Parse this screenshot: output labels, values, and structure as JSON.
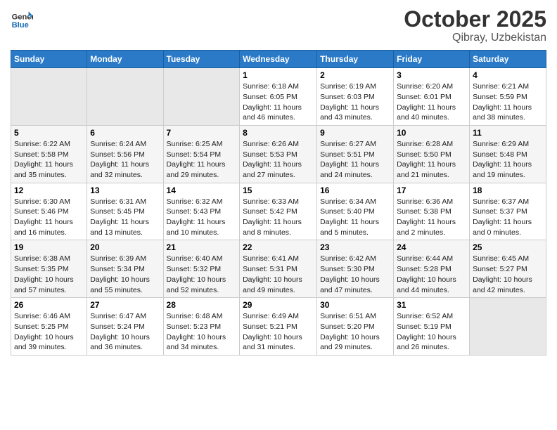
{
  "header": {
    "title": "October 2025",
    "location": "Qibray, Uzbekistan"
  },
  "calendar": {
    "days": [
      "Sunday",
      "Monday",
      "Tuesday",
      "Wednesday",
      "Thursday",
      "Friday",
      "Saturday"
    ]
  },
  "weeks": [
    [
      {
        "day": "",
        "sunrise": "",
        "sunset": "",
        "daylight": "",
        "empty": true
      },
      {
        "day": "",
        "sunrise": "",
        "sunset": "",
        "daylight": "",
        "empty": true
      },
      {
        "day": "",
        "sunrise": "",
        "sunset": "",
        "daylight": "",
        "empty": true
      },
      {
        "day": "1",
        "sunrise": "Sunrise: 6:18 AM",
        "sunset": "Sunset: 6:05 PM",
        "daylight": "Daylight: 11 hours and 46 minutes.",
        "empty": false
      },
      {
        "day": "2",
        "sunrise": "Sunrise: 6:19 AM",
        "sunset": "Sunset: 6:03 PM",
        "daylight": "Daylight: 11 hours and 43 minutes.",
        "empty": false
      },
      {
        "day": "3",
        "sunrise": "Sunrise: 6:20 AM",
        "sunset": "Sunset: 6:01 PM",
        "daylight": "Daylight: 11 hours and 40 minutes.",
        "empty": false
      },
      {
        "day": "4",
        "sunrise": "Sunrise: 6:21 AM",
        "sunset": "Sunset: 5:59 PM",
        "daylight": "Daylight: 11 hours and 38 minutes.",
        "empty": false
      }
    ],
    [
      {
        "day": "5",
        "sunrise": "Sunrise: 6:22 AM",
        "sunset": "Sunset: 5:58 PM",
        "daylight": "Daylight: 11 hours and 35 minutes.",
        "empty": false
      },
      {
        "day": "6",
        "sunrise": "Sunrise: 6:24 AM",
        "sunset": "Sunset: 5:56 PM",
        "daylight": "Daylight: 11 hours and 32 minutes.",
        "empty": false
      },
      {
        "day": "7",
        "sunrise": "Sunrise: 6:25 AM",
        "sunset": "Sunset: 5:54 PM",
        "daylight": "Daylight: 11 hours and 29 minutes.",
        "empty": false
      },
      {
        "day": "8",
        "sunrise": "Sunrise: 6:26 AM",
        "sunset": "Sunset: 5:53 PM",
        "daylight": "Daylight: 11 hours and 27 minutes.",
        "empty": false
      },
      {
        "day": "9",
        "sunrise": "Sunrise: 6:27 AM",
        "sunset": "Sunset: 5:51 PM",
        "daylight": "Daylight: 11 hours and 24 minutes.",
        "empty": false
      },
      {
        "day": "10",
        "sunrise": "Sunrise: 6:28 AM",
        "sunset": "Sunset: 5:50 PM",
        "daylight": "Daylight: 11 hours and 21 minutes.",
        "empty": false
      },
      {
        "day": "11",
        "sunrise": "Sunrise: 6:29 AM",
        "sunset": "Sunset: 5:48 PM",
        "daylight": "Daylight: 11 hours and 19 minutes.",
        "empty": false
      }
    ],
    [
      {
        "day": "12",
        "sunrise": "Sunrise: 6:30 AM",
        "sunset": "Sunset: 5:46 PM",
        "daylight": "Daylight: 11 hours and 16 minutes.",
        "empty": false
      },
      {
        "day": "13",
        "sunrise": "Sunrise: 6:31 AM",
        "sunset": "Sunset: 5:45 PM",
        "daylight": "Daylight: 11 hours and 13 minutes.",
        "empty": false
      },
      {
        "day": "14",
        "sunrise": "Sunrise: 6:32 AM",
        "sunset": "Sunset: 5:43 PM",
        "daylight": "Daylight: 11 hours and 10 minutes.",
        "empty": false
      },
      {
        "day": "15",
        "sunrise": "Sunrise: 6:33 AM",
        "sunset": "Sunset: 5:42 PM",
        "daylight": "Daylight: 11 hours and 8 minutes.",
        "empty": false
      },
      {
        "day": "16",
        "sunrise": "Sunrise: 6:34 AM",
        "sunset": "Sunset: 5:40 PM",
        "daylight": "Daylight: 11 hours and 5 minutes.",
        "empty": false
      },
      {
        "day": "17",
        "sunrise": "Sunrise: 6:36 AM",
        "sunset": "Sunset: 5:38 PM",
        "daylight": "Daylight: 11 hours and 2 minutes.",
        "empty": false
      },
      {
        "day": "18",
        "sunrise": "Sunrise: 6:37 AM",
        "sunset": "Sunset: 5:37 PM",
        "daylight": "Daylight: 11 hours and 0 minutes.",
        "empty": false
      }
    ],
    [
      {
        "day": "19",
        "sunrise": "Sunrise: 6:38 AM",
        "sunset": "Sunset: 5:35 PM",
        "daylight": "Daylight: 10 hours and 57 minutes.",
        "empty": false
      },
      {
        "day": "20",
        "sunrise": "Sunrise: 6:39 AM",
        "sunset": "Sunset: 5:34 PM",
        "daylight": "Daylight: 10 hours and 55 minutes.",
        "empty": false
      },
      {
        "day": "21",
        "sunrise": "Sunrise: 6:40 AM",
        "sunset": "Sunset: 5:32 PM",
        "daylight": "Daylight: 10 hours and 52 minutes.",
        "empty": false
      },
      {
        "day": "22",
        "sunrise": "Sunrise: 6:41 AM",
        "sunset": "Sunset: 5:31 PM",
        "daylight": "Daylight: 10 hours and 49 minutes.",
        "empty": false
      },
      {
        "day": "23",
        "sunrise": "Sunrise: 6:42 AM",
        "sunset": "Sunset: 5:30 PM",
        "daylight": "Daylight: 10 hours and 47 minutes.",
        "empty": false
      },
      {
        "day": "24",
        "sunrise": "Sunrise: 6:44 AM",
        "sunset": "Sunset: 5:28 PM",
        "daylight": "Daylight: 10 hours and 44 minutes.",
        "empty": false
      },
      {
        "day": "25",
        "sunrise": "Sunrise: 6:45 AM",
        "sunset": "Sunset: 5:27 PM",
        "daylight": "Daylight: 10 hours and 42 minutes.",
        "empty": false
      }
    ],
    [
      {
        "day": "26",
        "sunrise": "Sunrise: 6:46 AM",
        "sunset": "Sunset: 5:25 PM",
        "daylight": "Daylight: 10 hours and 39 minutes.",
        "empty": false
      },
      {
        "day": "27",
        "sunrise": "Sunrise: 6:47 AM",
        "sunset": "Sunset: 5:24 PM",
        "daylight": "Daylight: 10 hours and 36 minutes.",
        "empty": false
      },
      {
        "day": "28",
        "sunrise": "Sunrise: 6:48 AM",
        "sunset": "Sunset: 5:23 PM",
        "daylight": "Daylight: 10 hours and 34 minutes.",
        "empty": false
      },
      {
        "day": "29",
        "sunrise": "Sunrise: 6:49 AM",
        "sunset": "Sunset: 5:21 PM",
        "daylight": "Daylight: 10 hours and 31 minutes.",
        "empty": false
      },
      {
        "day": "30",
        "sunrise": "Sunrise: 6:51 AM",
        "sunset": "Sunset: 5:20 PM",
        "daylight": "Daylight: 10 hours and 29 minutes.",
        "empty": false
      },
      {
        "day": "31",
        "sunrise": "Sunrise: 6:52 AM",
        "sunset": "Sunset: 5:19 PM",
        "daylight": "Daylight: 10 hours and 26 minutes.",
        "empty": false
      },
      {
        "day": "",
        "sunrise": "",
        "sunset": "",
        "daylight": "",
        "empty": true
      }
    ]
  ]
}
